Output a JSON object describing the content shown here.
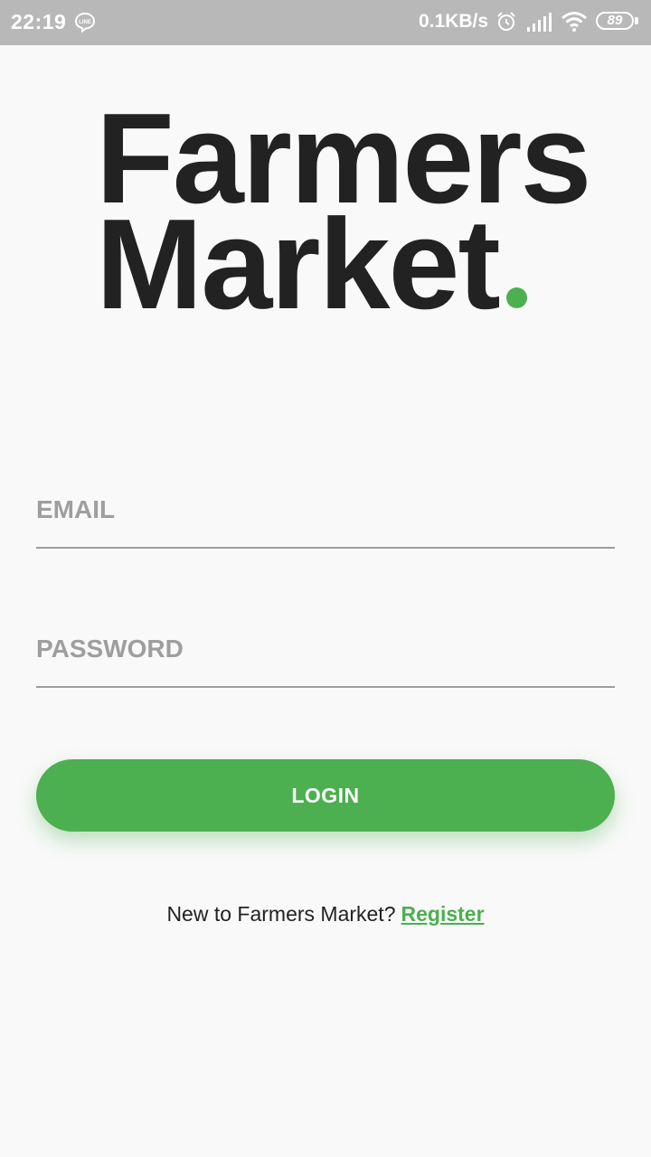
{
  "status_bar": {
    "time": "22:19",
    "network_speed": "0.1KB/s",
    "battery": "89",
    "icons": [
      "line-app-icon",
      "alarm-icon",
      "signal-icon",
      "wifi-icon",
      "battery-icon"
    ]
  },
  "logo": {
    "line1": "Farmers",
    "line2": "Market",
    "dot_color": "#4caf50"
  },
  "form": {
    "email_placeholder": "EMAIL",
    "email_value": "",
    "password_placeholder": "PASSWORD",
    "password_value": ""
  },
  "login_button": {
    "label": "LOGIN",
    "color": "#4caf50"
  },
  "register": {
    "prompt": "New to Farmers Market?",
    "link": "Register"
  }
}
